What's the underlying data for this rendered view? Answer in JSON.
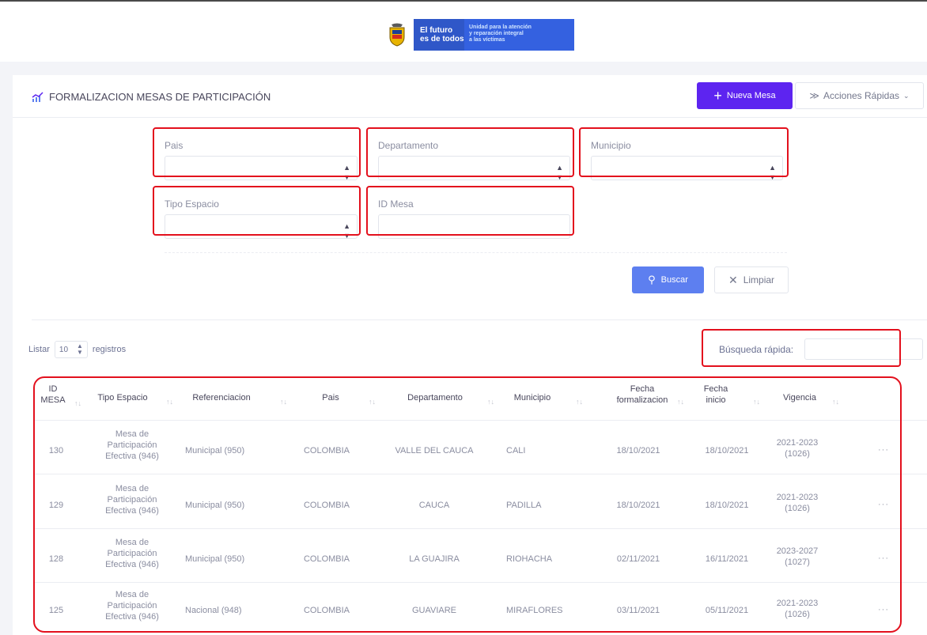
{
  "banner": {
    "main": "El futuro\nes de todos",
    "sub": "Unidad para la atención\ny reparación integral\na las víctimas"
  },
  "page": {
    "title": "FORMALIZACION MESAS DE PARTICIPACIÓN",
    "title_icon": "chart-line-icon"
  },
  "toolbar": {
    "new_label": "Nueva Mesa",
    "quick_actions_label": "Acciones Rápidas"
  },
  "filters": {
    "pais_label": "Pais",
    "pais_value": "",
    "departamento_label": "Departamento",
    "departamento_value": "",
    "municipio_label": "Municipio",
    "municipio_value": "",
    "tipo_espacio_label": "Tipo Espacio",
    "tipo_espacio_value": "",
    "id_mesa_label": "ID Mesa",
    "id_mesa_value": ""
  },
  "actions": {
    "search_label": "Buscar",
    "clear_label": "Limpiar"
  },
  "table_controls": {
    "list_label": "Listar",
    "page_size": "10",
    "records_label": "registros",
    "quick_search_label": "Búsqueda rápida:",
    "quick_search_value": ""
  },
  "table": {
    "headers": {
      "id": "ID\nMESA",
      "tipo": "Tipo Espacio",
      "referenciacion": "Referenciacion",
      "pais": "Pais",
      "departamento": "Departamento",
      "municipio": "Municipio",
      "fecha_form": "Fecha\nformalizacion",
      "fecha_inicio": "Fecha\ninicio",
      "vigencia": "Vigencia"
    },
    "rows": [
      {
        "id": "130",
        "tipo": "Mesa de\nParticipación\nEfectiva (946)",
        "referenciacion": "Municipal (950)",
        "pais": "COLOMBIA",
        "departamento": "VALLE DEL CAUCA",
        "municipio": "CALI",
        "fecha_form": "18/10/2021",
        "fecha_inicio": "18/10/2021",
        "vigencia": "2021-2023\n(1026)",
        "more": "···"
      },
      {
        "id": "129",
        "tipo": "Mesa de\nParticipación\nEfectiva (946)",
        "referenciacion": "Municipal (950)",
        "pais": "COLOMBIA",
        "departamento": "CAUCA",
        "municipio": "PADILLA",
        "fecha_form": "18/10/2021",
        "fecha_inicio": "18/10/2021",
        "vigencia": "2021-2023\n(1026)",
        "more": "···"
      },
      {
        "id": "128",
        "tipo": "Mesa de\nParticipación\nEfectiva (946)",
        "referenciacion": "Municipal (950)",
        "pais": "COLOMBIA",
        "departamento": "LA GUAJIRA",
        "municipio": "RIOHACHA",
        "fecha_form": "02/11/2021",
        "fecha_inicio": "16/11/2021",
        "vigencia": "2023-2027\n(1027)",
        "more": "···"
      },
      {
        "id": "125",
        "tipo": "Mesa de\nParticipación\nEfectiva (946)",
        "referenciacion": "Nacional (948)",
        "pais": "COLOMBIA",
        "departamento": "GUAVIARE",
        "municipio": "MIRAFLORES",
        "fecha_form": "03/11/2021",
        "fecha_inicio": "05/11/2021",
        "vigencia": "2021-2023\n(1026)",
        "more": "···"
      }
    ]
  },
  "colors": {
    "primary": "#5d24f0",
    "search": "#5d7ff0",
    "highlight": "#e3101d",
    "banner": "#2f57c8"
  }
}
